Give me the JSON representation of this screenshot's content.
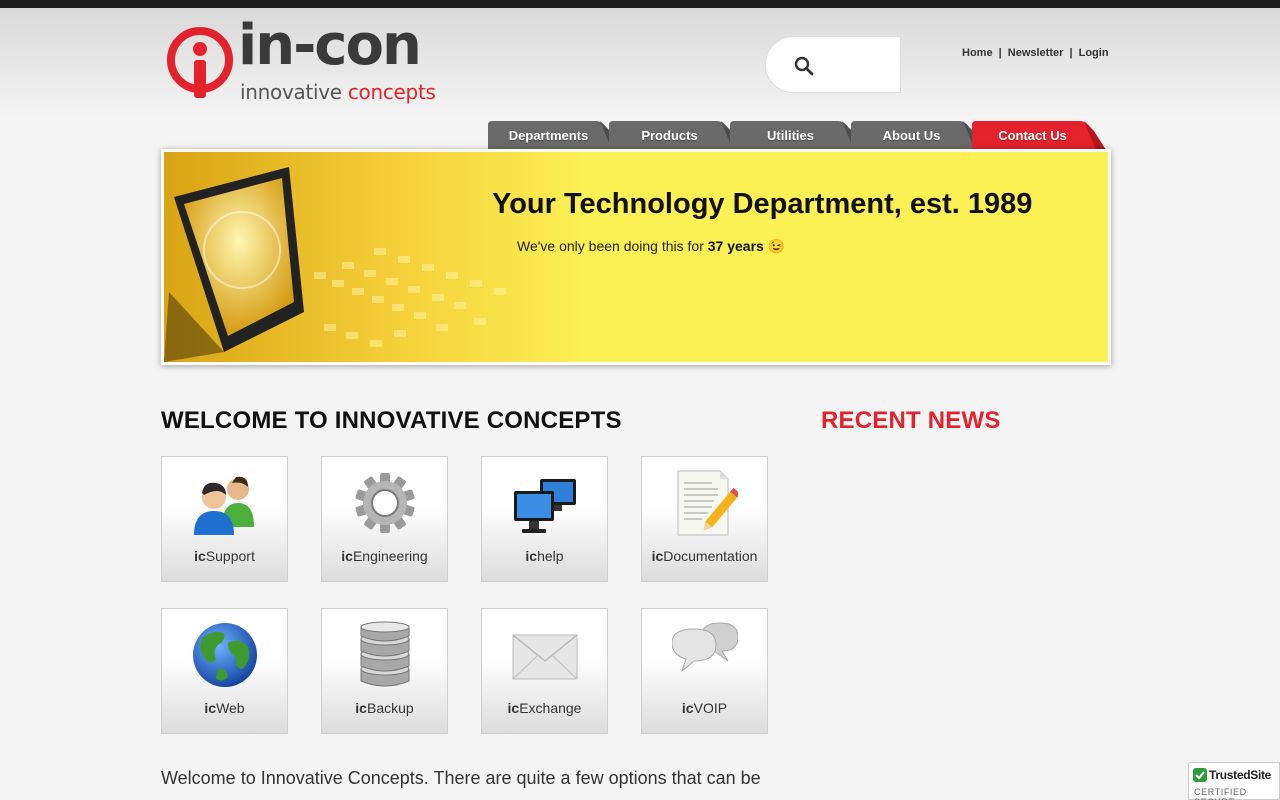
{
  "logo": {
    "word": "in-con",
    "tagline_part1": "innovative ",
    "tagline_part2": "concepts"
  },
  "search": {
    "placeholder": "",
    "value": ""
  },
  "toplinks": {
    "home": "Home",
    "sep": "|",
    "newsletter": "Newsletter",
    "login": "Login"
  },
  "nav": [
    "Departments",
    "Products",
    "Utilities",
    "About Us",
    "Contact Us"
  ],
  "banner": {
    "title": "Your Technology Department, est. 1989",
    "subtitle_pre": "We've only been doing this for ",
    "subtitle_bold": "37 years",
    "subtitle_emoji": "😉"
  },
  "welcome_heading": "WELCOME TO INNOVATIVE CONCEPTS",
  "news_heading": "RECENT NEWS",
  "tiles": [
    {
      "prefix": "ic",
      "name": "Support",
      "icon": "users-icon"
    },
    {
      "prefix": "ic",
      "name": "Engineering",
      "icon": "gear-icon"
    },
    {
      "prefix": "ic",
      "name": "help",
      "icon": "monitors-icon"
    },
    {
      "prefix": "ic",
      "name": "Documentation",
      "icon": "document-pencil-icon"
    },
    {
      "prefix": "ic",
      "name": "Web",
      "icon": "globe-icon"
    },
    {
      "prefix": "ic",
      "name": "Backup",
      "icon": "database-icon"
    },
    {
      "prefix": "ic",
      "name": "Exchange",
      "icon": "envelope-icon"
    },
    {
      "prefix": "ic",
      "name": "VOIP",
      "icon": "speech-bubbles-icon"
    }
  ],
  "intro_text": "Welcome to Innovative Concepts. There are quite a few options that can be found here. Most importantly, if you want to talk with a live person, and we",
  "trusted": {
    "title": "TrustedSite",
    "subtitle": "CERTIFIED SECURE"
  },
  "colors": {
    "brand_red": "#e3222b",
    "tab_gray": "#6a6a6a",
    "banner_yellow": "#fbf054"
  }
}
